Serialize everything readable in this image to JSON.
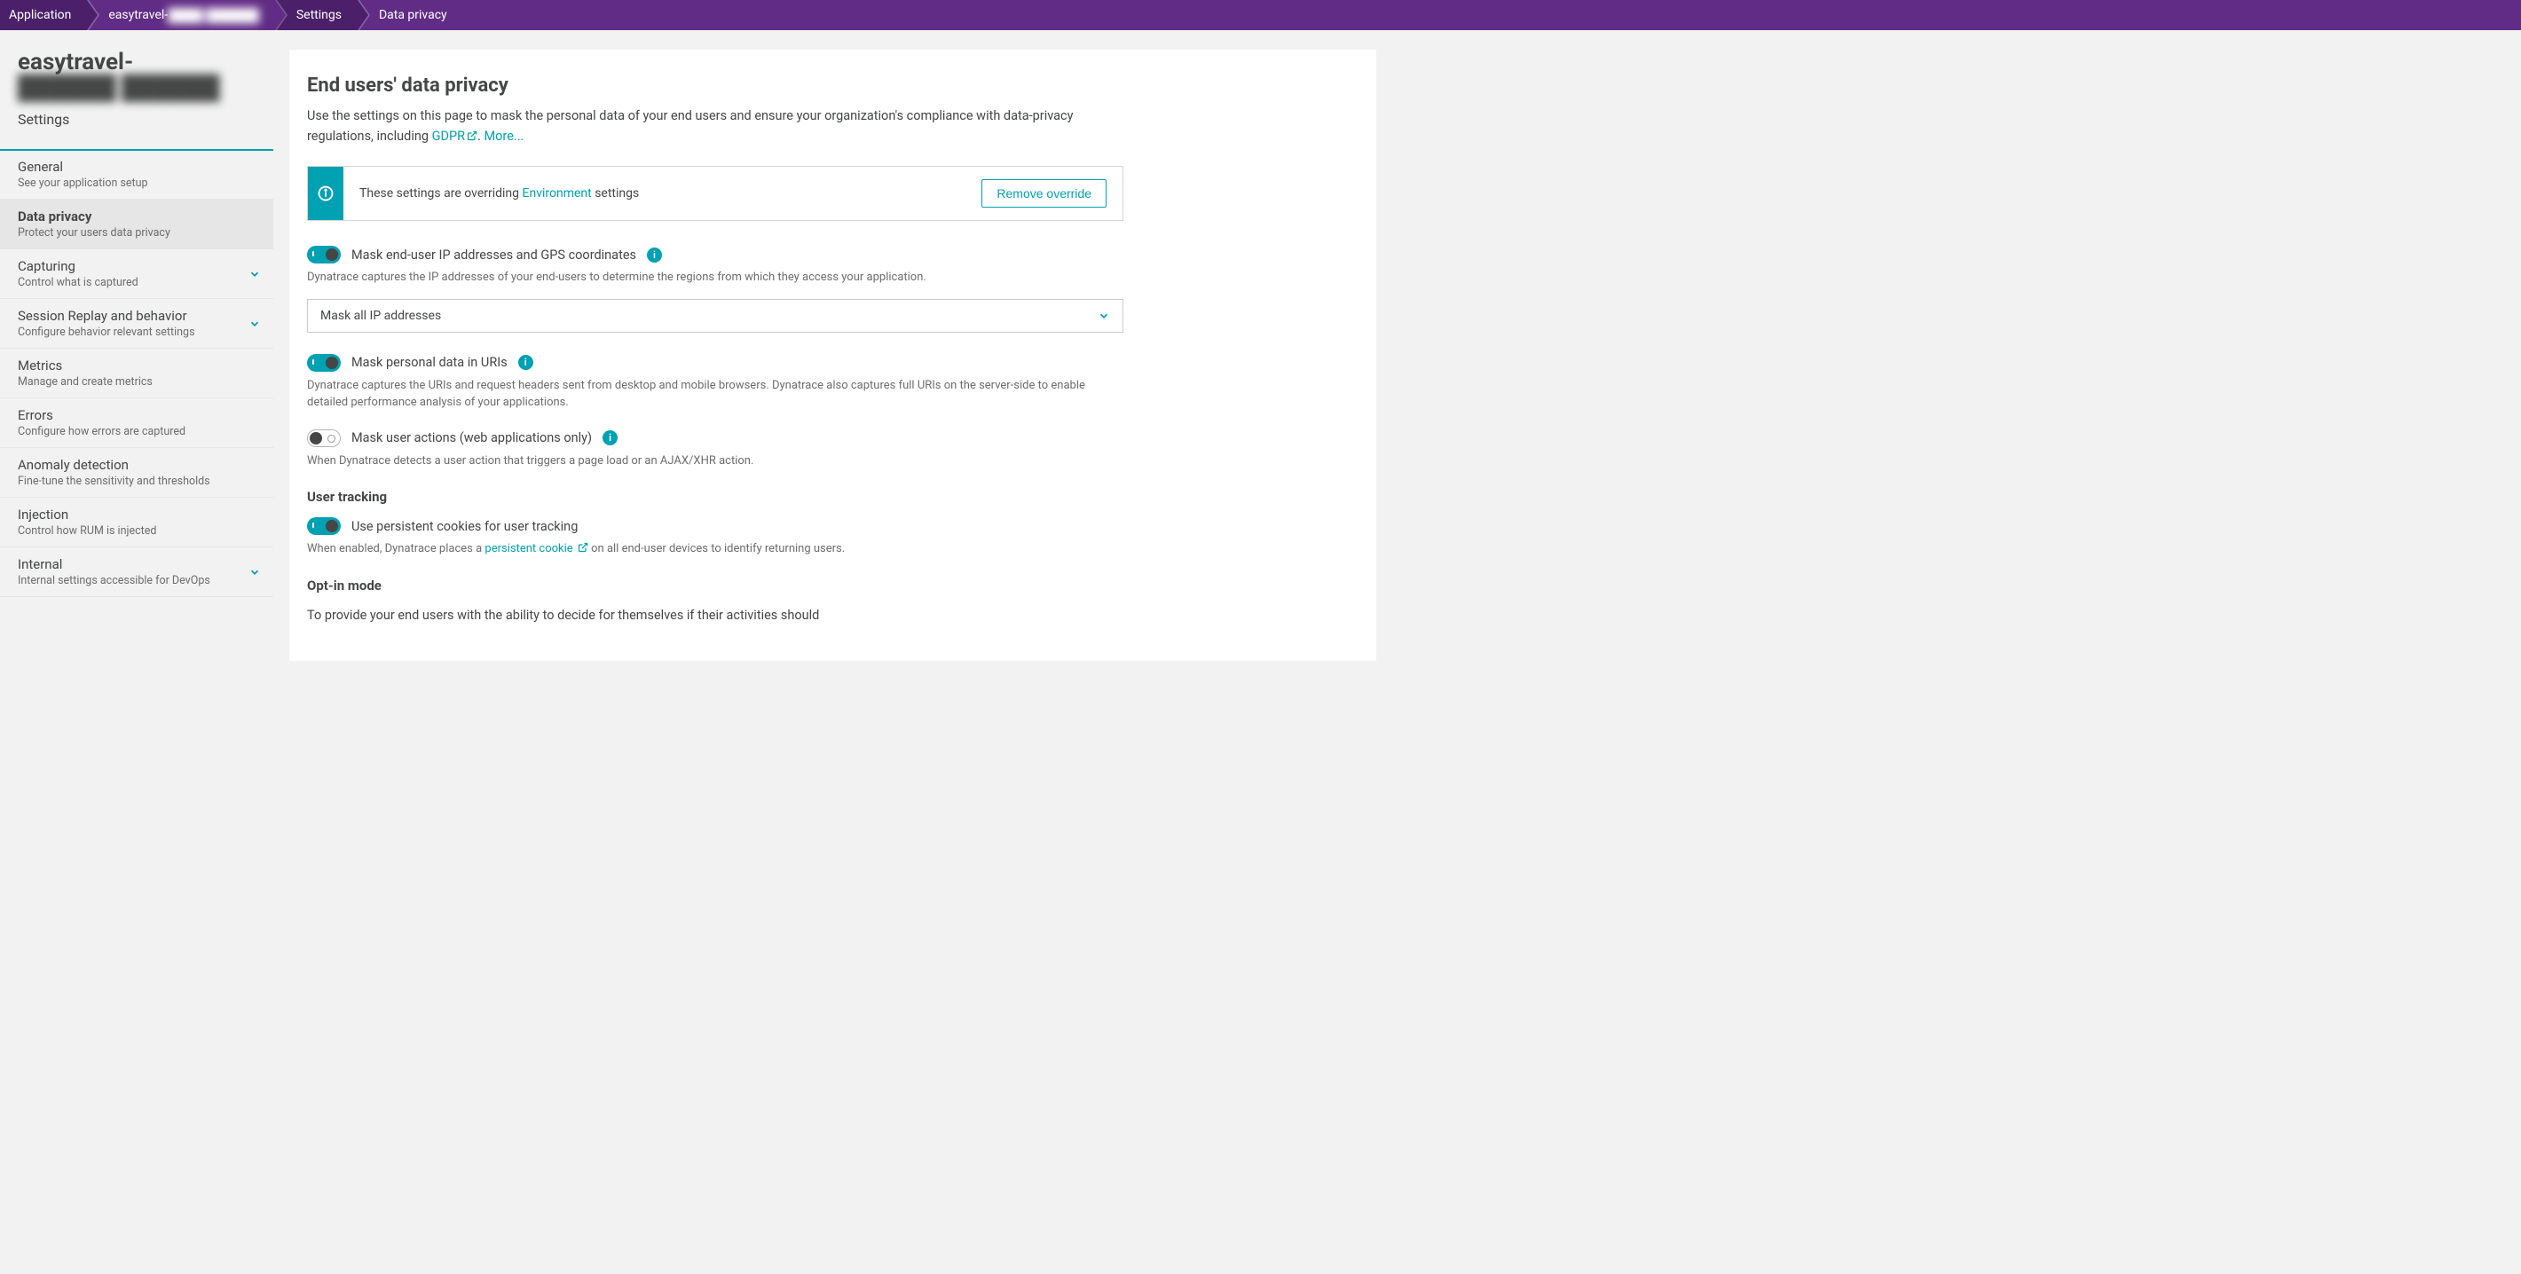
{
  "breadcrumb": {
    "items": [
      "Application",
      "easytravel-",
      "Settings",
      "Data privacy"
    ],
    "app_obscured": "████ ██████"
  },
  "sidebar": {
    "app_title": "easytravel-",
    "app_title_obscured": "██████ ██████",
    "settings_label": "Settings",
    "items": [
      {
        "title": "General",
        "sub": "See your application setup",
        "expandable": false
      },
      {
        "title": "Data privacy",
        "sub": "Protect your users data privacy",
        "expandable": false
      },
      {
        "title": "Capturing",
        "sub": "Control what is captured",
        "expandable": true
      },
      {
        "title": "Session Replay and behavior",
        "sub": "Configure behavior relevant settings",
        "expandable": true
      },
      {
        "title": "Metrics",
        "sub": "Manage and create metrics",
        "expandable": false
      },
      {
        "title": "Errors",
        "sub": "Configure how errors are captured",
        "expandable": false
      },
      {
        "title": "Anomaly detection",
        "sub": "Fine-tune the sensitivity and thresholds",
        "expandable": false
      },
      {
        "title": "Injection",
        "sub": "Control how RUM is injected",
        "expandable": false
      },
      {
        "title": "Internal",
        "sub": "Internal settings accessible for DevOps",
        "expandable": true
      }
    ]
  },
  "main": {
    "title": "End users' data privacy",
    "desc_pre": "Use the settings on this page to mask the personal data of your end users and ensure your organization's compliance with data-privacy regulations, including ",
    "gdpr_link": "GDPR",
    "desc_post": ". ",
    "more_link": "More...",
    "banner": {
      "text_pre": "These settings are overriding ",
      "env_link": "Environment",
      "text_post": " settings",
      "button": "Remove override"
    },
    "settings": {
      "mask_ip": {
        "label": "Mask end-user IP addresses and GPS coordinates",
        "desc": "Dynatrace captures the IP addresses of your end-users to determine the regions from which they access your application.",
        "on": true,
        "select_value": "Mask all IP addresses"
      },
      "mask_uri": {
        "label": "Mask personal data in URIs",
        "desc": "Dynatrace captures the URIs and request headers sent from desktop and mobile browsers. Dynatrace also captures full URIs on the server-side to enable detailed performance analysis of your applications.",
        "on": true
      },
      "mask_actions": {
        "label": "Mask user actions (web applications only)",
        "desc": "When Dynatrace detects a user action that triggers a page load or an AJAX/XHR action.",
        "on": false
      }
    },
    "user_tracking": {
      "heading": "User tracking",
      "cookie": {
        "label": "Use persistent cookies for user tracking",
        "on": true,
        "desc_pre": "When enabled, Dynatrace places a ",
        "link": "persistent cookie",
        "desc_post": " on all end-user devices to identify returning users."
      }
    },
    "optin": {
      "heading": "Opt-in mode",
      "desc": "To provide your end users with the ability to decide for themselves if their activities should"
    }
  }
}
